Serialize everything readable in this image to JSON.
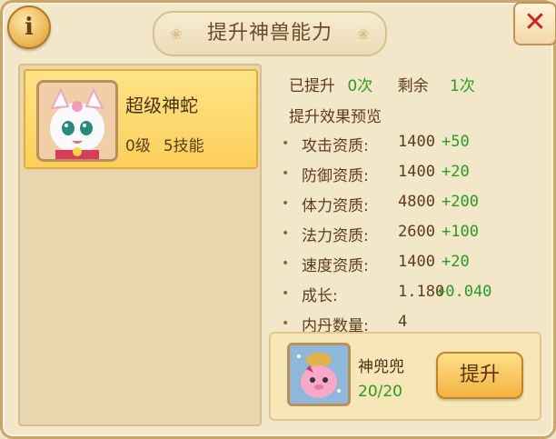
{
  "dialog": {
    "title": "提升神兽能力",
    "info_glyph": "i",
    "close_glyph": "✕"
  },
  "pet": {
    "name": "超级神蛇",
    "level": "0级",
    "skills": "5技能",
    "portrait_icon": "white-dragon-portrait"
  },
  "upgrade": {
    "improved_label": "已提升",
    "improved_value": "0次",
    "remaining_label": "剩余",
    "remaining_value": "1次",
    "preview_header": "提升效果预览",
    "stats": [
      {
        "label": "攻击资质:",
        "value": "1400",
        "inc": "+50"
      },
      {
        "label": "防御资质:",
        "value": "1400",
        "inc": "+20"
      },
      {
        "label": "体力资质:",
        "value": "4800",
        "inc": "+200"
      },
      {
        "label": "法力资质:",
        "value": "2600",
        "inc": "+100"
      },
      {
        "label": "速度资质:",
        "value": "1400",
        "inc": "+20"
      },
      {
        "label": "成长:",
        "value": "1.180",
        "inc": "+0.040"
      },
      {
        "label": "内丹数量:",
        "value": "4",
        "inc": ""
      }
    ]
  },
  "item": {
    "name": "神兜兜",
    "count": "20/20",
    "icon": "pink-pig-bag-icon",
    "button_label": "提升"
  },
  "colors": {
    "accent_green": "#2a9a22",
    "close_red": "#d02020"
  }
}
